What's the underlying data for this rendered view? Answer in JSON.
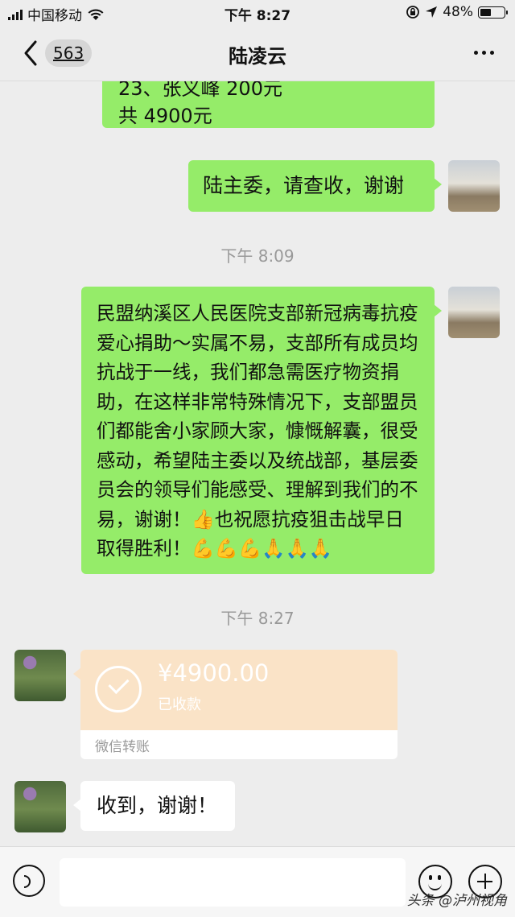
{
  "status_bar": {
    "carrier": "中国移动",
    "time": "下午 8:27",
    "battery_percent": "48%",
    "battery_level": 0.48,
    "icons": [
      "signal-icon",
      "wifi-icon",
      "lock-rotation-icon",
      "location-icon",
      "battery-icon"
    ]
  },
  "nav": {
    "back_icon": "chevron-left-icon",
    "unread_count": "563",
    "title": "陆凌云",
    "more_icon": "more-dots-icon"
  },
  "messages": {
    "m1": {
      "sender": "self",
      "text": "23、张义峰 200元\n共 4900元"
    },
    "m2": {
      "sender": "self",
      "text": "陆主委，请查收，谢谢"
    },
    "t1": "下午 8:09",
    "m3": {
      "sender": "self",
      "text": "民盟纳溪区人民医院支部新冠病毒抗疫爱心捐助～实属不易，支部所有成员均抗战于一线，我们都急需医疗物资捐助，在这样非常特殊情况下，支部盟员们都能舍小家顾大家，慷慨解囊，很受感动，希望陆主委以及统战部，基层委员会的领导们能感受、理解到我们的不易，谢谢！👍也祝愿抗疫狙击战早日取得胜利！💪💪💪🙏🙏🙏"
    },
    "t2": "下午 8:27",
    "transfer": {
      "sender": "other",
      "amount": "¥4900.00",
      "status": "已收款",
      "source": "微信转账"
    },
    "m4": {
      "sender": "other",
      "text": "收到，谢谢！"
    }
  },
  "input_bar": {
    "voice_icon": "voice-icon",
    "placeholder": "",
    "emoji_icon": "emoji-icon",
    "plus_icon": "plus-icon"
  },
  "watermark": "头条 @泸州视角",
  "colors": {
    "background": "#ededed",
    "self_bubble": "#95ec69",
    "other_bubble": "#ffffff",
    "transfer_card": "#fae3c7",
    "timestamp": "#999999"
  }
}
